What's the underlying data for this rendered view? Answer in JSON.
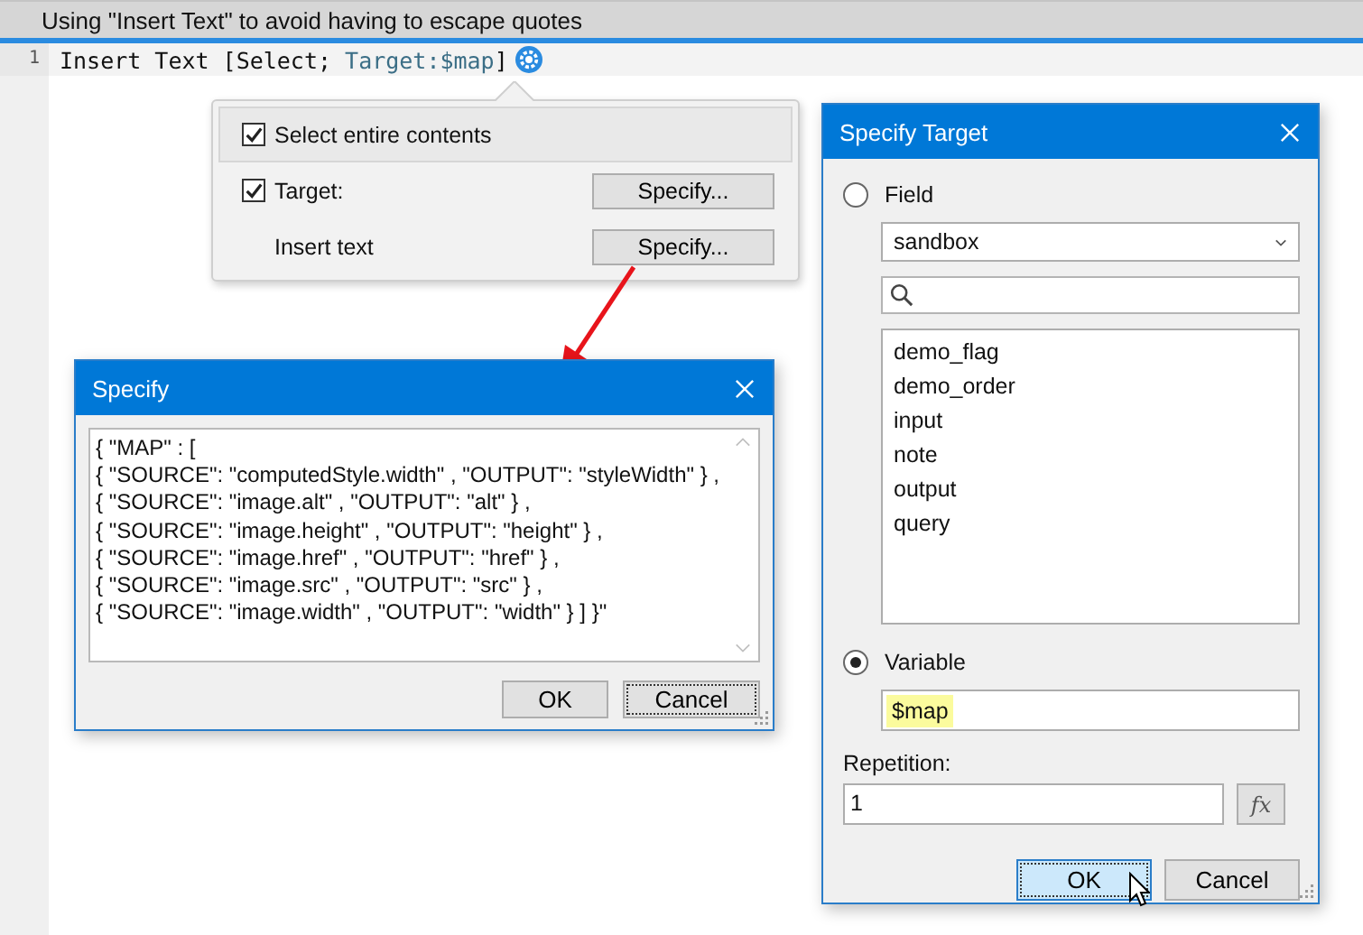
{
  "header": {
    "title": "Using \"Insert Text\" to avoid having to escape quotes"
  },
  "editor": {
    "lines": [
      {
        "number": "1",
        "segments": [
          {
            "kind": "plain",
            "text": "Insert Text [Select; "
          },
          {
            "kind": "param",
            "text": "Target:$map"
          },
          {
            "kind": "plain",
            "text": "]"
          }
        ]
      }
    ]
  },
  "options_popover": {
    "rows": [
      {
        "kind": "checkbox",
        "label": "Select entire contents",
        "checked": true,
        "selected": true
      },
      {
        "kind": "checkbox",
        "label": "Target:",
        "checked": true,
        "selected": false,
        "button": "Specify..."
      },
      {
        "kind": "plain",
        "label": "Insert text",
        "selected": false,
        "button": "Specify..."
      }
    ]
  },
  "specify_dialog": {
    "title": "Specify",
    "content": "{ \"MAP\" : [\n{ \"SOURCE\": \"computedStyle.width\" , \"OUTPUT\": \"styleWidth\" } ,\n{ \"SOURCE\": \"image.alt\" , \"OUTPUT\": \"alt\" } ,\n{ \"SOURCE\": \"image.height\" , \"OUTPUT\": \"height\" } ,\n{ \"SOURCE\": \"image.href\" , \"OUTPUT\": \"href\" } ,\n{ \"SOURCE\": \"image.src\" , \"OUTPUT\": \"src\" } ,\n{ \"SOURCE\": \"image.width\" , \"OUTPUT\": \"width\" } ] }\"",
    "buttons": [
      {
        "label": "OK",
        "focused": false
      },
      {
        "label": "Cancel",
        "focused": true
      }
    ]
  },
  "target_dialog": {
    "title": "Specify Target",
    "field_option": {
      "label": "Field",
      "selected": false
    },
    "table": "sandbox",
    "fields": [
      {
        "name": "demo_flag"
      },
      {
        "name": "demo_order"
      },
      {
        "name": "input"
      },
      {
        "name": "note"
      },
      {
        "name": "output"
      },
      {
        "name": "query"
      }
    ],
    "variable_option": {
      "label": "Variable",
      "selected": true
    },
    "variable": "$map",
    "repetition_label": "Repetition:",
    "repetition": "1",
    "formula_button": "fx",
    "buttons": [
      {
        "label": "OK",
        "focused": true
      },
      {
        "label": "Cancel",
        "focused": false
      }
    ]
  }
}
